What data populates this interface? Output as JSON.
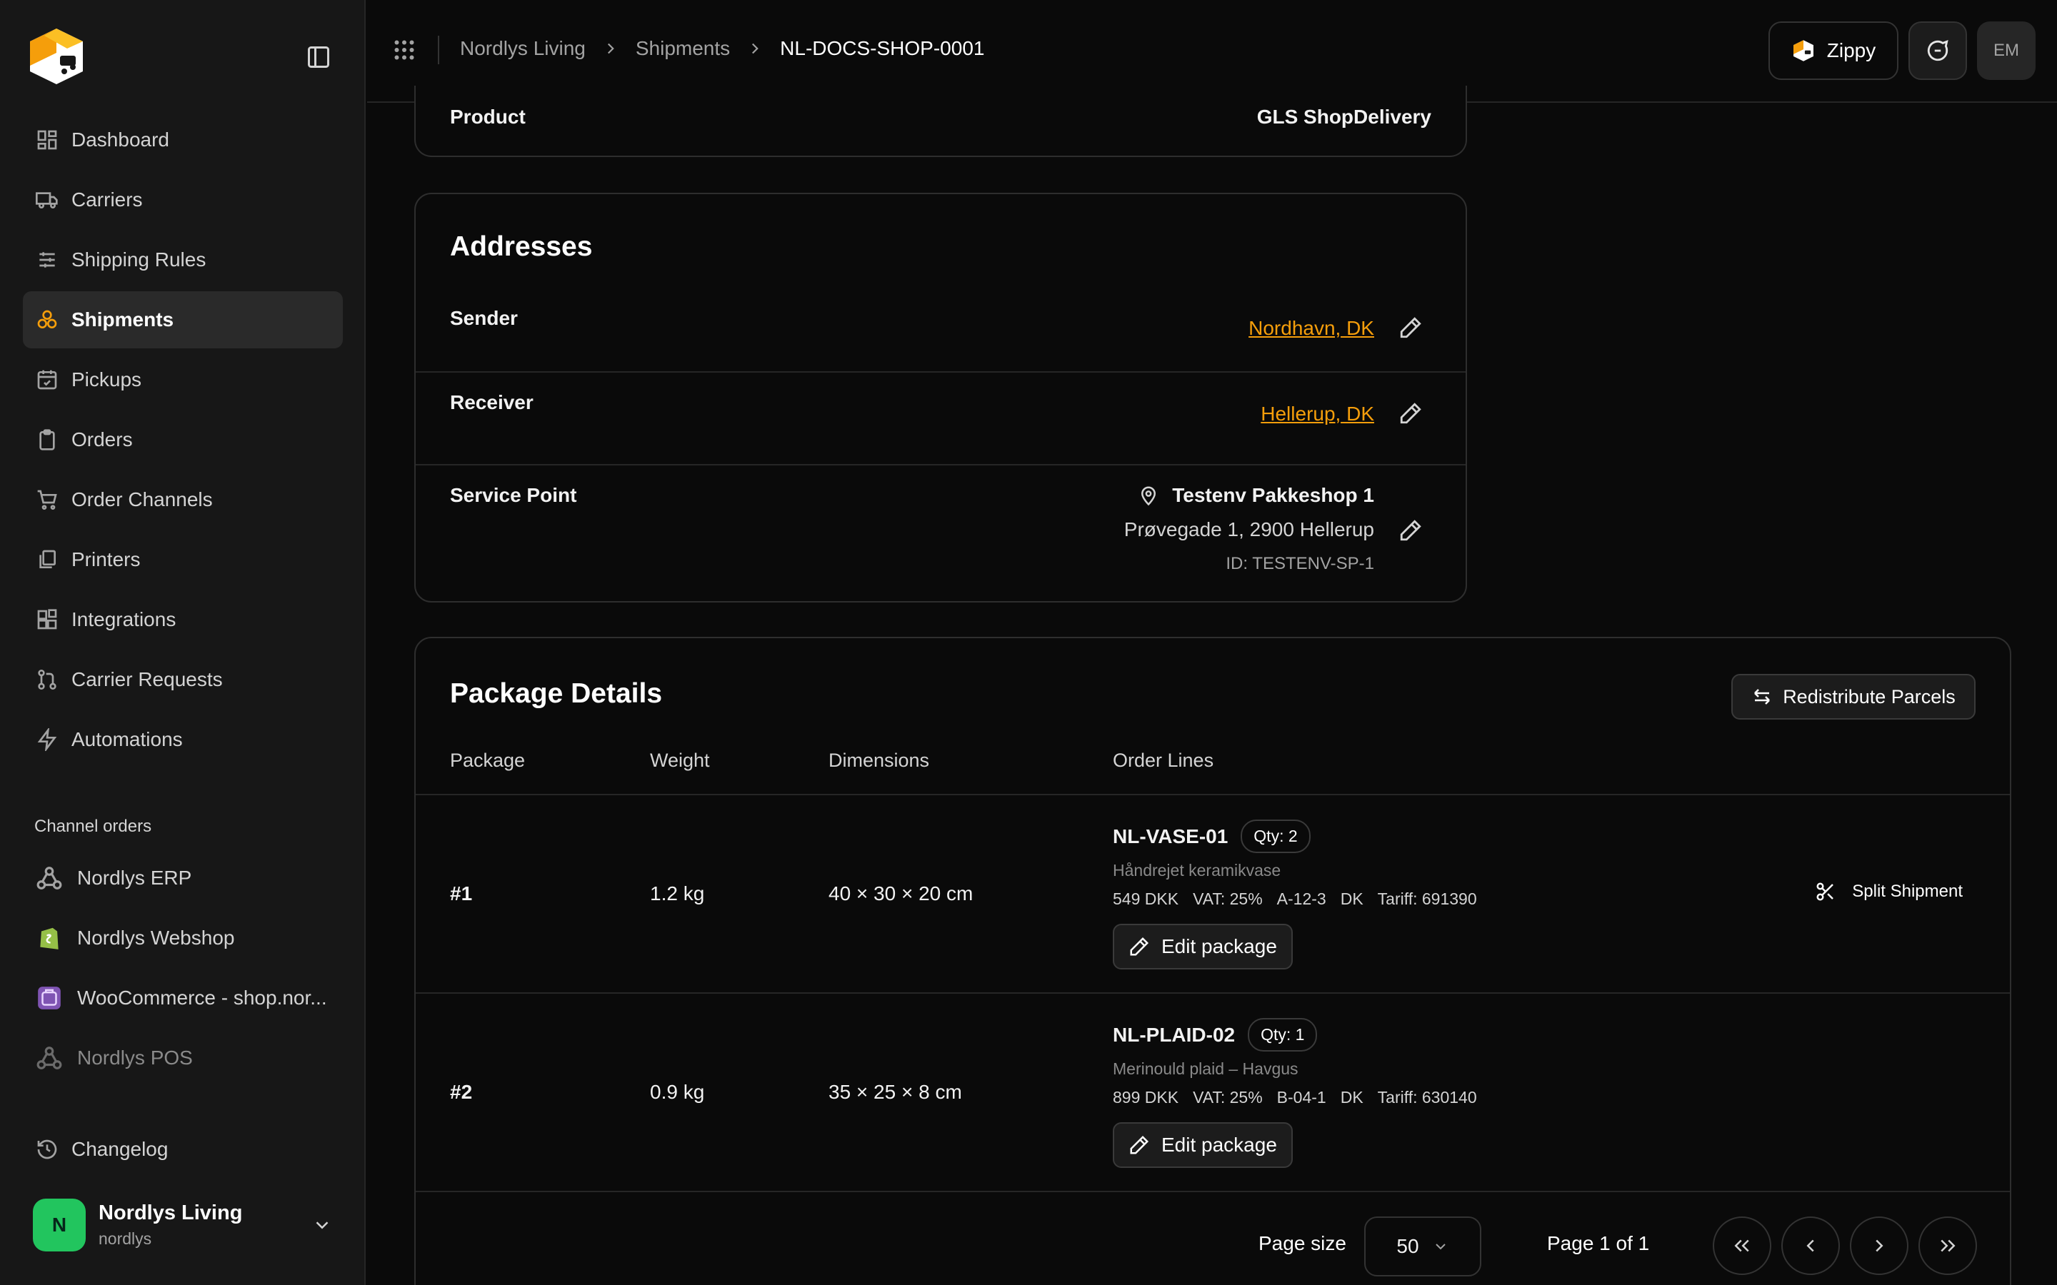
{
  "sidebar": {
    "nav": [
      {
        "label": "Dashboard",
        "icon": "dashboard-icon"
      },
      {
        "label": "Carriers",
        "icon": "truck-icon"
      },
      {
        "label": "Shipping Rules",
        "icon": "sliders-icon"
      },
      {
        "label": "Shipments",
        "icon": "boxes-icon",
        "active": true
      },
      {
        "label": "Pickups",
        "icon": "calendar-check-icon"
      },
      {
        "label": "Orders",
        "icon": "clipboard-icon"
      },
      {
        "label": "Order Channels",
        "icon": "cart-icon"
      },
      {
        "label": "Printers",
        "icon": "printer-icon"
      },
      {
        "label": "Integrations",
        "icon": "blocks-icon"
      },
      {
        "label": "Carrier Requests",
        "icon": "git-pull-request-icon"
      },
      {
        "label": "Automations",
        "icon": "zap-icon"
      }
    ],
    "channels_title": "Channel orders",
    "channels": [
      {
        "label": "Nordlys ERP",
        "icon": "webhook-icon"
      },
      {
        "label": "Nordlys Webshop",
        "icon": "shopify-icon"
      },
      {
        "label": "WooCommerce - shop.nor...",
        "icon": "woocommerce-icon"
      },
      {
        "label": "Nordlys POS",
        "icon": "webhook-icon",
        "muted": true
      }
    ],
    "changelog_label": "Changelog",
    "account": {
      "initial": "N",
      "name": "Nordlys Living",
      "handle": "nordlys"
    }
  },
  "topbar": {
    "breadcrumb": [
      "Nordlys Living",
      "Shipments",
      "NL-DOCS-SHOP-0001"
    ],
    "assistant_label": "Zippy",
    "user_initials": "EM"
  },
  "product": {
    "label": "Product",
    "value": "GLS ShopDelivery"
  },
  "addresses": {
    "title": "Addresses",
    "sender": {
      "label": "Sender",
      "value": "Nordhavn, DK"
    },
    "receiver": {
      "label": "Receiver",
      "value": "Hellerup, DK"
    },
    "service_point": {
      "label": "Service Point",
      "name": "Testenv Pakkeshop 1",
      "address": "Prøvegade 1, 2900 Hellerup",
      "id": "ID: TESTENV-SP-1"
    }
  },
  "packages": {
    "title": "Package Details",
    "redistribute_label": "Redistribute Parcels",
    "columns": [
      "Package",
      "Weight",
      "Dimensions",
      "Order Lines"
    ],
    "rows": [
      {
        "number": "#1",
        "weight": "1.2 kg",
        "dimensions": "40 × 30 × 20 cm",
        "sku": "NL-VASE-01",
        "qty": "Qty: 2",
        "description": "Håndrejet keramikvase",
        "meta": [
          "549 DKK",
          "VAT: 25%",
          "A-12-3",
          "DK",
          "Tariff: 691390"
        ],
        "edit_label": "Edit package",
        "split_label": "Split Shipment"
      },
      {
        "number": "#2",
        "weight": "0.9 kg",
        "dimensions": "35 × 25 × 8 cm",
        "sku": "NL-PLAID-02",
        "qty": "Qty: 1",
        "description": "Merinould plaid – Havgus",
        "meta": [
          "899 DKK",
          "VAT: 25%",
          "B-04-1",
          "DK",
          "Tariff: 630140"
        ],
        "edit_label": "Edit package"
      }
    ],
    "pagination": {
      "page_size_label": "Page size",
      "page_size": "50",
      "page_label": "Page 1 of 1"
    }
  },
  "colors": {
    "accent": "#f59e0b",
    "avatar": "#22c55e",
    "background": "#0a0a0a",
    "sidebar": "#171717"
  }
}
